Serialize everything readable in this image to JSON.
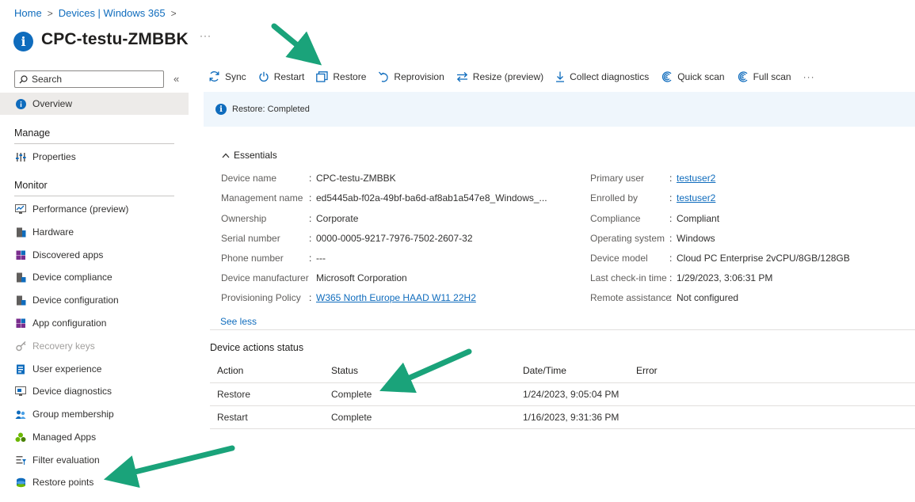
{
  "breadcrumb": {
    "items": [
      "Home",
      "Devices | Windows 365"
    ]
  },
  "page": {
    "title": "CPC-testu-ZMBBK",
    "more": "···"
  },
  "sidebar": {
    "search_placeholder": "Search",
    "collapse": "«",
    "overview": "Overview",
    "sections": {
      "manage": "Manage",
      "monitor": "Monitor"
    },
    "manage_items": [
      {
        "label": "Properties",
        "icon": "properties-icon"
      }
    ],
    "monitor_items": [
      {
        "label": "Performance (preview)",
        "icon": "performance-icon"
      },
      {
        "label": "Hardware",
        "icon": "hardware-icon"
      },
      {
        "label": "Discovered apps",
        "icon": "apps-icon"
      },
      {
        "label": "Device compliance",
        "icon": "compliance-icon"
      },
      {
        "label": "Device configuration",
        "icon": "configuration-icon"
      },
      {
        "label": "App configuration",
        "icon": "app-configuration-icon"
      },
      {
        "label": "Recovery keys",
        "icon": "key-icon",
        "disabled": true
      },
      {
        "label": "User experience",
        "icon": "user-experience-icon"
      },
      {
        "label": "Device diagnostics",
        "icon": "diagnostics-icon"
      },
      {
        "label": "Group membership",
        "icon": "group-icon"
      },
      {
        "label": "Managed Apps",
        "icon": "managed-apps-icon"
      },
      {
        "label": "Filter evaluation",
        "icon": "filter-icon"
      },
      {
        "label": "Restore points",
        "icon": "restore-points-icon"
      }
    ]
  },
  "toolbar": {
    "sync": "Sync",
    "restart": "Restart",
    "restore": "Restore",
    "reprovision": "Reprovision",
    "resize": "Resize (preview)",
    "collect_diagnostics": "Collect diagnostics",
    "quick_scan": "Quick scan",
    "full_scan": "Full scan",
    "more": "···"
  },
  "banner": {
    "text": "Restore: Completed"
  },
  "essentials": {
    "title": "Essentials",
    "left": [
      {
        "label": "Device name",
        "value": "CPC-testu-ZMBBK"
      },
      {
        "label": "Management name",
        "value": "ed5445ab-f02a-49bf-ba6d-af8ab1a547e8_Windows_..."
      },
      {
        "label": "Ownership",
        "value": "Corporate"
      },
      {
        "label": "Serial number",
        "value": "0000-0005-9217-7976-7502-2607-32"
      },
      {
        "label": "Phone number",
        "value": "---"
      },
      {
        "label": "Device manufacturer",
        "value": "Microsoft Corporation"
      },
      {
        "label": "Provisioning Policy",
        "value": "W365 North Europe HAAD W11 22H2",
        "link": true
      }
    ],
    "right": [
      {
        "label": "Primary user",
        "value": "testuser2",
        "link": true
      },
      {
        "label": "Enrolled by",
        "value": "testuser2",
        "link": true
      },
      {
        "label": "Compliance",
        "value": "Compliant"
      },
      {
        "label": "Operating system",
        "value": "Windows"
      },
      {
        "label": "Device model",
        "value": "Cloud PC Enterprise 2vCPU/8GB/128GB"
      },
      {
        "label": "Last check-in time",
        "value": "1/29/2023, 3:06:31 PM"
      },
      {
        "label": "Remote assistance",
        "value": "Not configured"
      }
    ],
    "see_less": "See less"
  },
  "device_actions": {
    "title": "Device actions status",
    "columns": [
      "Action",
      "Status",
      "Date/Time",
      "Error"
    ],
    "rows": [
      [
        "Restore",
        "Complete",
        "1/24/2023, 9:05:04 PM",
        ""
      ],
      [
        "Restart",
        "Complete",
        "1/16/2023, 9:31:36 PM",
        ""
      ]
    ]
  },
  "colors": {
    "accent": "#0f6cbd",
    "annotation_arrow": "#1aa37a",
    "banner_bg": "#eff6fc",
    "selected_nav_bg": "#edebe9"
  }
}
